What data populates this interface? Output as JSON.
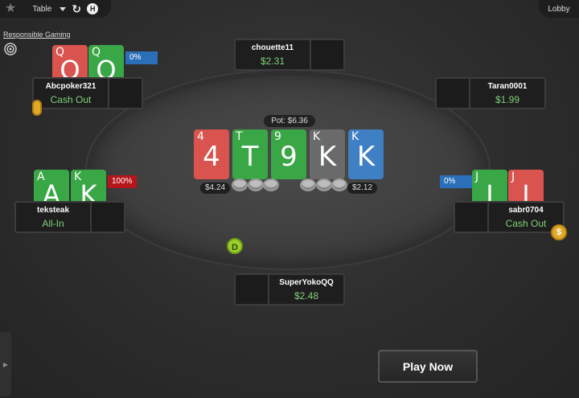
{
  "topbar": {
    "table_menu_label": "Table",
    "lobby_label": "Lobby"
  },
  "responsible_gaming": "Responsible Gaming",
  "pot_label": "Pot: $6.36",
  "board": [
    {
      "small": "4",
      "big": "4",
      "color": "#d9534f"
    },
    {
      "small": "T",
      "big": "T",
      "color": "#3aa746"
    },
    {
      "small": "9",
      "big": "9",
      "color": "#3aa746"
    },
    {
      "small": "K",
      "big": "K",
      "color": "#6a6a6a"
    },
    {
      "small": "K",
      "big": "K",
      "color": "#3f7fc4"
    }
  ],
  "bets": {
    "left": "$4.24",
    "right": "$2.12"
  },
  "dealer_label": "D",
  "players": {
    "top": {
      "name": "chouette11",
      "amount": "$2.31"
    },
    "top_left": {
      "name": "Abcpoker321",
      "status": "Cash Out",
      "equity": "0%",
      "cards": [
        {
          "small": "Q",
          "big": "Q"
        },
        {
          "small": "Q",
          "big": "Q"
        }
      ]
    },
    "top_right": {
      "name": "Taran0001",
      "amount": "$1.99"
    },
    "left": {
      "name": "teksteak",
      "status": "All-In",
      "equity": "100%",
      "cards": [
        {
          "small": "A",
          "big": "A"
        },
        {
          "small": "K",
          "big": "K"
        }
      ]
    },
    "right": {
      "name": "sabr0704",
      "status": "Cash Out",
      "equity": "0%",
      "cards": [
        {
          "small": "J",
          "big": "J"
        },
        {
          "small": "J",
          "big": "J"
        }
      ]
    },
    "bottom": {
      "name": "SuperYokoQQ",
      "amount": "$2.48"
    }
  },
  "play_now_label": "Play Now",
  "colors": {
    "accent_green": "#7fd07a",
    "equity_blue": "#2b6fb8",
    "equity_red": "#b5151b",
    "dealer_green": "#9ccf2b"
  }
}
